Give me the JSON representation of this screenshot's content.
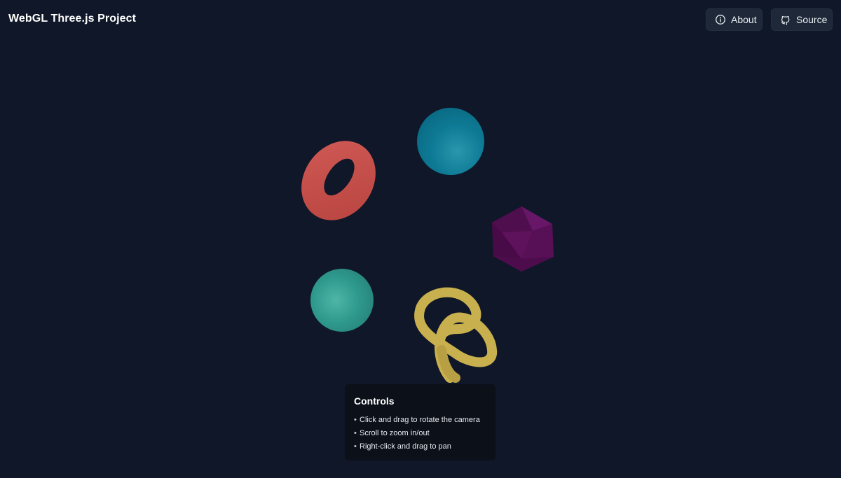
{
  "header": {
    "title": "WebGL Three.js Project",
    "about_label": "About",
    "source_label": "Source",
    "about_icon": "info-icon",
    "source_icon": "github-icon"
  },
  "scene": {
    "objects": [
      {
        "name": "torus",
        "color": "#c5524f"
      },
      {
        "name": "sphere",
        "color": "#0e7a95"
      },
      {
        "name": "icosahedron",
        "color": "#4f0d4f"
      },
      {
        "name": "cone",
        "color": "#2f9a8e"
      },
      {
        "name": "torus-knot",
        "color": "#c9b04e"
      }
    ],
    "background": "#0f1728"
  },
  "controls": {
    "title": "Controls",
    "items": [
      "Click and drag to rotate the camera",
      "Scroll to zoom in/out",
      "Right-click and drag to pan"
    ]
  }
}
